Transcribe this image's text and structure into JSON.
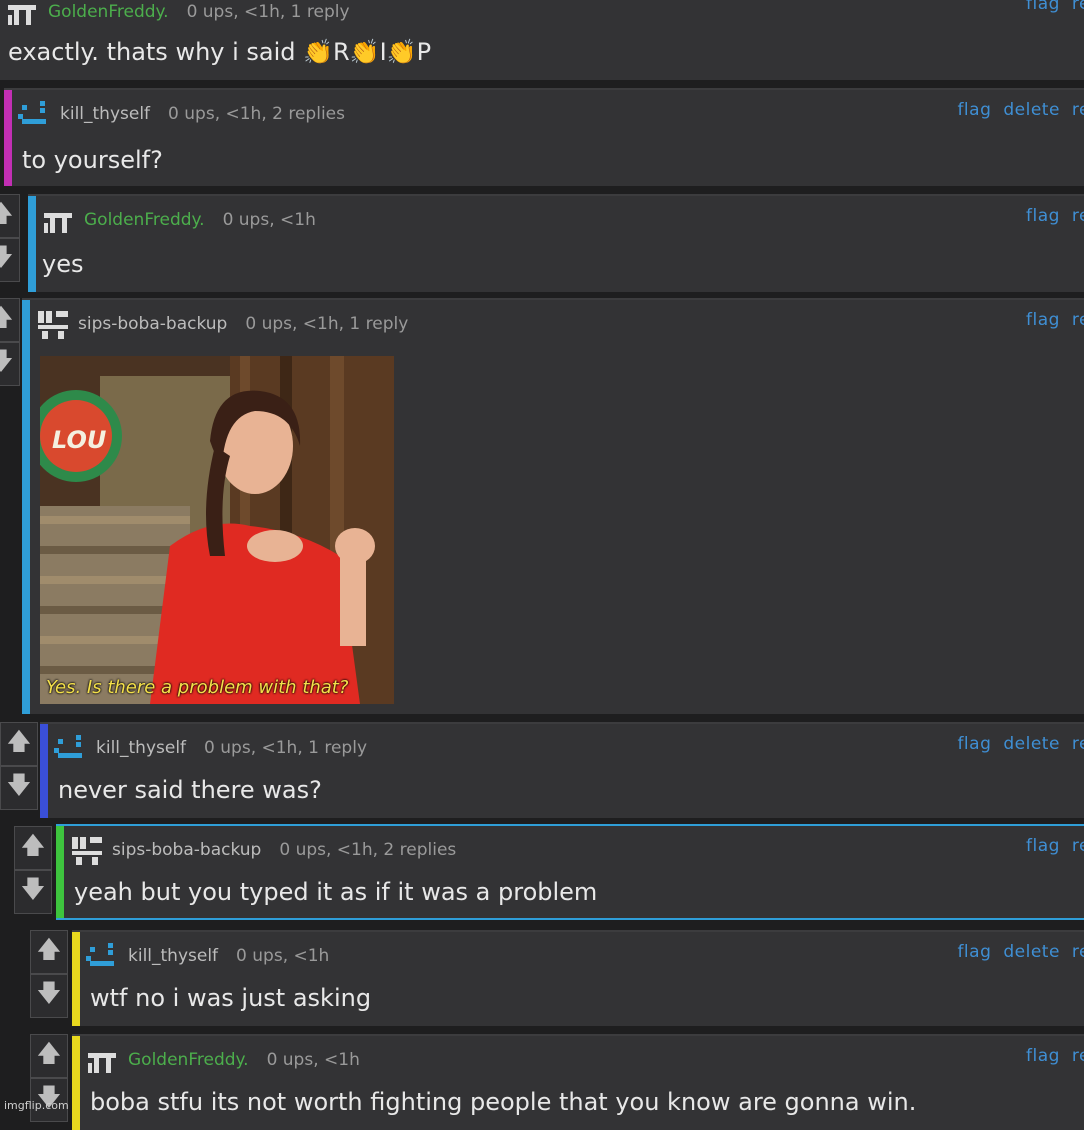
{
  "comments": [
    {
      "user": "GoldenFreddy.",
      "meta": "0 ups, <1h, 1 reply",
      "actions": [
        "flag",
        "re"
      ],
      "text_parts": [
        "exactly. thats why i said ",
        "👏",
        "R",
        "👏",
        "I",
        "👏",
        "P"
      ]
    },
    {
      "user": "kill_thyself",
      "meta": "0 ups, <1h, 2 replies",
      "actions": [
        "flag",
        "delete",
        "re"
      ],
      "text": "to yourself?"
    },
    {
      "user": "GoldenFreddy.",
      "meta": "0 ups, <1h",
      "actions": [
        "flag",
        "re"
      ],
      "text": "yes"
    },
    {
      "user": "sips-boba-backup",
      "meta": "0 ups, <1h, 1 reply",
      "actions": [
        "flag",
        "re"
      ],
      "image": {
        "logo_text": "LOU",
        "caption": "Yes. Is there a problem with that?"
      }
    },
    {
      "user": "kill_thyself",
      "meta": "0 ups, <1h, 1 reply",
      "actions": [
        "flag",
        "delete",
        "re"
      ],
      "text": "never said there was?"
    },
    {
      "user": "sips-boba-backup",
      "meta": "0 ups, <1h, 2 replies",
      "actions": [
        "flag",
        "re"
      ],
      "text": "yeah but you typed it as if it was a problem"
    },
    {
      "user": "kill_thyself",
      "meta": "0 ups, <1h",
      "actions": [
        "flag",
        "delete",
        "re"
      ],
      "text": "wtf no i was just asking"
    },
    {
      "user": "GoldenFreddy.",
      "meta": "0 ups, <1h",
      "actions": [
        "flag",
        "re"
      ],
      "text": "boba stfu its not worth fighting people that you know are gonna win."
    }
  ],
  "vote": {
    "up_icon": "🡅",
    "down_icon": "🡇"
  },
  "watermark": "imgflip.com",
  "colors": {
    "link": "#3f8fd4",
    "green_user": "#4cae4c",
    "bar_magenta": "#c22fb4",
    "bar_blue": "#2f9ed8",
    "bar_indigo": "#3a4fd8",
    "bar_green": "#3ec43e",
    "bar_yellow": "#e8d81e"
  }
}
